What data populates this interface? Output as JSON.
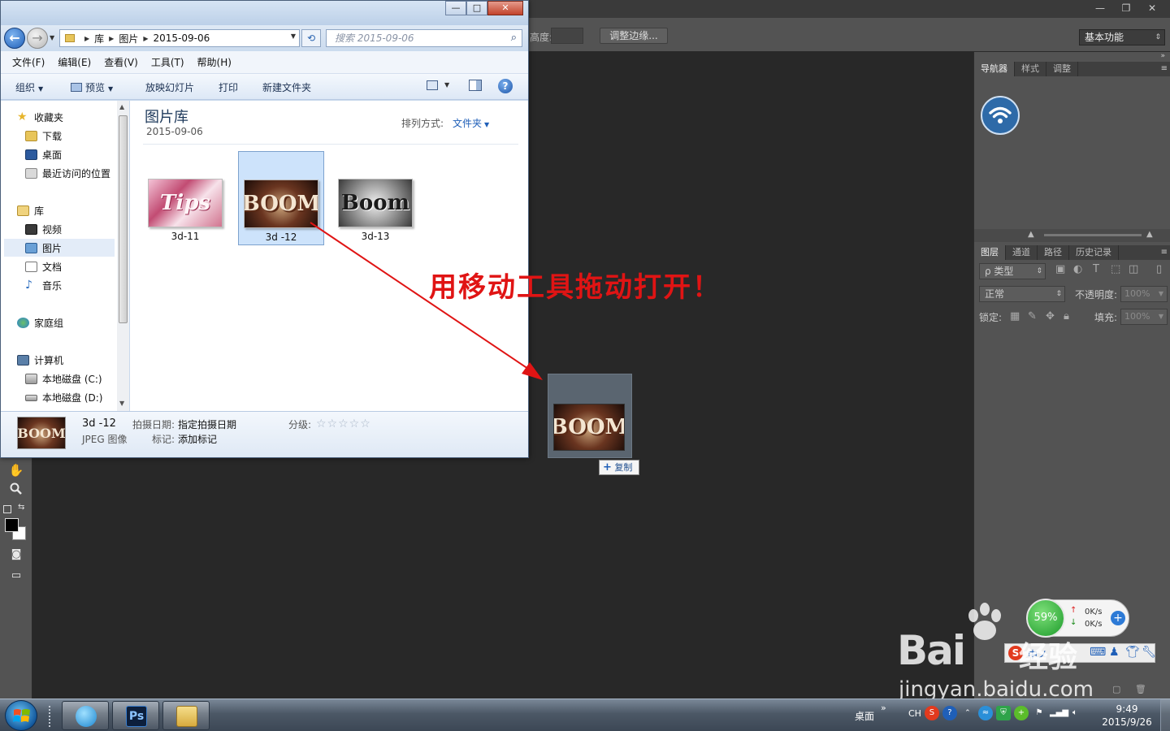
{
  "photoshop": {
    "options_bar": {
      "height_label": "高度:",
      "refine_edge_button": "调整边缘..."
    },
    "workspace": "基本功能",
    "window_controls": [
      "—",
      "❐",
      "✕"
    ],
    "panels": {
      "top_tabs": [
        "导航器",
        "样式",
        "调整"
      ],
      "layers_tabs": [
        "图层",
        "通道",
        "路径",
        "历史记录"
      ],
      "filter_kind": "ρ 类型",
      "blend_mode": "正常",
      "opacity_label": "不透明度:",
      "opacity_value": "100%",
      "lock_label": "锁定:",
      "fill_label": "填充:",
      "fill_value": "100%"
    }
  },
  "explorer": {
    "caption_buttons": [
      "—",
      "□",
      "✕"
    ],
    "breadcrumb": [
      "库",
      "图片",
      "2015-09-06"
    ],
    "search_placeholder": "搜索 2015-09-06",
    "menu": [
      "文件(F)",
      "编辑(E)",
      "查看(V)",
      "工具(T)",
      "帮助(H)"
    ],
    "commands": {
      "organize": "组织",
      "preview": "预览",
      "slideshow": "放映幻灯片",
      "print": "打印",
      "new_folder": "新建文件夹"
    },
    "nav": {
      "favorites": "收藏夹",
      "downloads": "下载",
      "desktop": "桌面",
      "recent": "最近访问的位置",
      "libraries": "库",
      "videos": "视频",
      "pictures": "图片",
      "documents": "文档",
      "music": "音乐",
      "homegroup": "家庭组",
      "computer": "计算机",
      "drive_c": "本地磁盘 (C:)",
      "drive_d": "本地磁盘 (D:)"
    },
    "library": {
      "title": "图片库",
      "subtitle": "2015-09-06",
      "arrange_label": "排列方式:",
      "arrange_value": "文件夹"
    },
    "files": [
      {
        "name": "3d-11",
        "art": "tips"
      },
      {
        "name": "3d -12",
        "art": "boom",
        "selected": true
      },
      {
        "name": "3d-13",
        "art": "bw"
      }
    ],
    "details": {
      "name": "3d -12",
      "type": "JPEG 图像",
      "date_label": "拍摄日期:",
      "date_value": "指定拍摄日期",
      "tags_label": "标记:",
      "tags_value": "添加标记",
      "rating_label": "分级:",
      "rating_stars": "☆☆☆☆☆"
    }
  },
  "annotation": {
    "text": "用移动工具拖动打开！",
    "color": "#e01414"
  },
  "drag": {
    "badge": "复制",
    "badge_plus": "+"
  },
  "art_text": {
    "tips": "Tips",
    "boom": "BOOM",
    "bw": "Boom"
  },
  "widget360": {
    "percent": "59%",
    "up": "0K/s",
    "down": "0K/s",
    "plus": "+"
  },
  "ime": {
    "text": "中ノ"
  },
  "watermark": {
    "brand": "Bai",
    "suffix": "经验",
    "url": "jingyan.baidu.com"
  },
  "taskbar": {
    "desktop_label": "桌面",
    "chevron": "»",
    "lang": "CH",
    "time": "9:49",
    "date": "2015/9/26",
    "ps_label": "Ps"
  }
}
